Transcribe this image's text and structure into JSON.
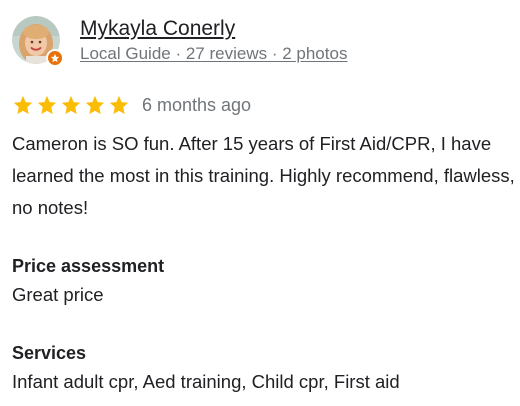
{
  "review": {
    "author": {
      "name": "Mykayla Conerly",
      "guide_label": "Local Guide",
      "separator": " · ",
      "reviews": "27 reviews",
      "photos": "2 photos"
    },
    "rating": 5,
    "rating_max": 5,
    "star_color": "#fbbc04",
    "badge_color": "#e8710a",
    "time": "6 months ago",
    "text": "Cameron is SO fun. After 15 years of First Aid/CPR, I have learned the most in this training. Highly recommend, flawless, no notes!",
    "details": [
      {
        "heading": "Price assessment",
        "value": "Great price"
      },
      {
        "heading": "Services",
        "value": "Infant adult cpr, Aed training, Child cpr, First aid"
      }
    ]
  },
  "icons": {
    "avatar": "user-avatar-photo",
    "badge": "local-guide-star-icon",
    "star": "star-filled-icon"
  }
}
